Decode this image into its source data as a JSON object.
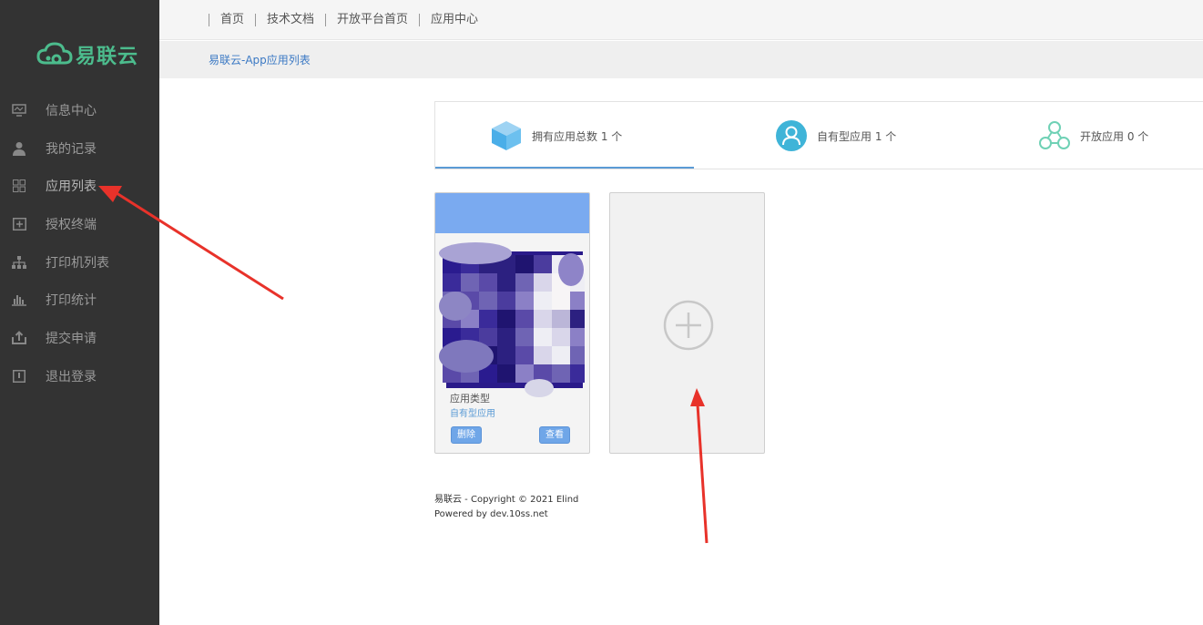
{
  "brand": {
    "name": "易联云",
    "color": "#4cbc8d"
  },
  "sidebar": {
    "items": [
      {
        "label": "信息中心",
        "icon": "monitor-icon"
      },
      {
        "label": "我的记录",
        "icon": "user-icon"
      },
      {
        "label": "应用列表",
        "icon": "grid-icon"
      },
      {
        "label": "授权终端",
        "icon": "plus-box-icon"
      },
      {
        "label": "打印机列表",
        "icon": "network-icon"
      },
      {
        "label": "打印统计",
        "icon": "bar-chart-icon"
      },
      {
        "label": "提交申请",
        "icon": "upload-icon"
      },
      {
        "label": "退出登录",
        "icon": "exit-icon"
      }
    ],
    "active_index": 2
  },
  "topnav": [
    "首页",
    "技术文档",
    "开放平台首页",
    "应用中心"
  ],
  "breadcrumb": "易联云-App应用列表",
  "stats": {
    "total": {
      "text": "拥有应用总数 1 个",
      "icon": "cube-icon"
    },
    "own": {
      "text": "自有型应用 1 个",
      "icon": "user-circle-icon"
    },
    "open": {
      "text": "开放应用 0 个",
      "icon": "molecule-icon"
    }
  },
  "app_card": {
    "type_label": "应用类型",
    "type_value": "自有型应用",
    "delete_label": "删除",
    "view_label": "查看"
  },
  "add_card": {
    "icon": "plus-circle-icon"
  },
  "footer": {
    "line1": "易联云 - Copyright © 2021 Elind",
    "line2": "Powered by dev.10ss.net"
  },
  "colors": {
    "sidebar": "#333333",
    "accent": "#5b9bd5",
    "annotation": "#e8322a"
  }
}
